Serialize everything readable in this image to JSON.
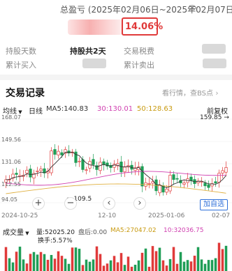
{
  "header": {
    "title": "总盈亏 (2025年02月06日~2025年02月07日)",
    "return_pct": "14.06%"
  },
  "stats": {
    "hold_days_label": "持股天数",
    "hold_days_value": "持股共2天",
    "tax_label": "交易税费",
    "buy_label": "累计买入",
    "sell_label": "累计卖出"
  },
  "trade": {
    "title": "交易记录",
    "link": "看行情，查BS点"
  },
  "chart_header": {
    "type_select": "均线",
    "period": "日线",
    "ma5": "MA5:140.83",
    "ma30": "30:130.01",
    "ma50": "50:128.63",
    "adjust": "前复权"
  },
  "chart_data": {
    "type": "candlestick",
    "y_ticks": [
      "168.07",
      "149.56",
      "131.06",
      "112.55",
      "94.05"
    ],
    "x_ticks": [
      "2024-10-25",
      "12-10",
      "2025-01-06",
      "02-07"
    ],
    "high_label": "159.85",
    "low_label": "109.5",
    "series": [
      {
        "name": "MA5",
        "color": "#e0a020"
      },
      {
        "name": "30",
        "color": "#d040b0"
      },
      {
        "name": "50",
        "color": "#4a7fdb"
      }
    ]
  },
  "controls": {
    "add_watch": "加自选"
  },
  "volume": {
    "tab": "成交量",
    "vol": "量:52025.20",
    "after": "盘后:0.00",
    "ma5": "MA5:27047.02",
    "ma10": "10:32036.75",
    "turnover": "换手:5.57%"
  },
  "colors": {
    "up": "#e03a3a",
    "down": "#1f9e57",
    "accent": "#2e6fd9"
  }
}
